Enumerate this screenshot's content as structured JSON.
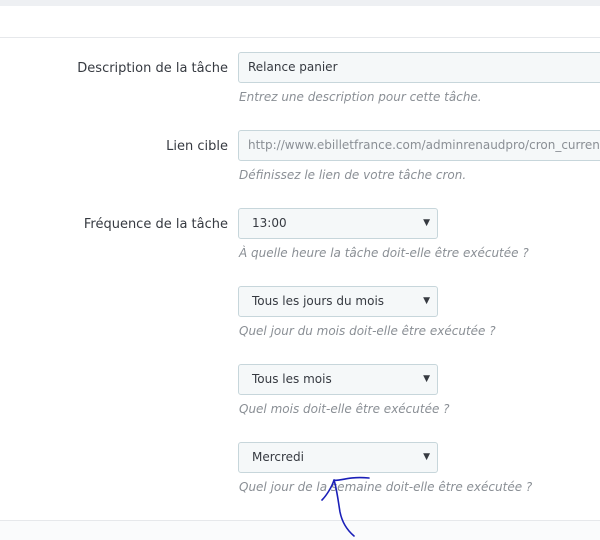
{
  "form": {
    "description": {
      "label": "Description de la tâche",
      "value": "Relance panier",
      "help": "Entrez une description pour cette tâche."
    },
    "target_link": {
      "label": "Lien cible",
      "value": "http://www.ebilletfrance.com/adminrenaudpro/cron_currency_",
      "help": "Définissez le lien de votre tâche cron."
    },
    "frequency": {
      "label": "Fréquence de la tâche",
      "hour": {
        "value": "13:00",
        "help": "À quelle heure la tâche doit-elle être exécutée ?"
      },
      "day_of_month": {
        "value": "Tous les jours du mois",
        "help": "Quel jour du mois doit-elle être exécutée ?"
      },
      "month": {
        "value": "Tous les mois",
        "help": "Quel mois doit-elle être exécutée ?"
      },
      "weekday": {
        "value": "Mercredi",
        "help": "Quel jour de la semaine doit-elle être exécutée ?"
      }
    }
  },
  "icons": {
    "dropdown": "caret-down-icon",
    "caret_glyph": "▼"
  },
  "colors": {
    "annotation": "#1a1fb8",
    "field_border": "#c7d6db",
    "field_bg": "#f5f8f9",
    "help_text": "#8a8f95"
  }
}
